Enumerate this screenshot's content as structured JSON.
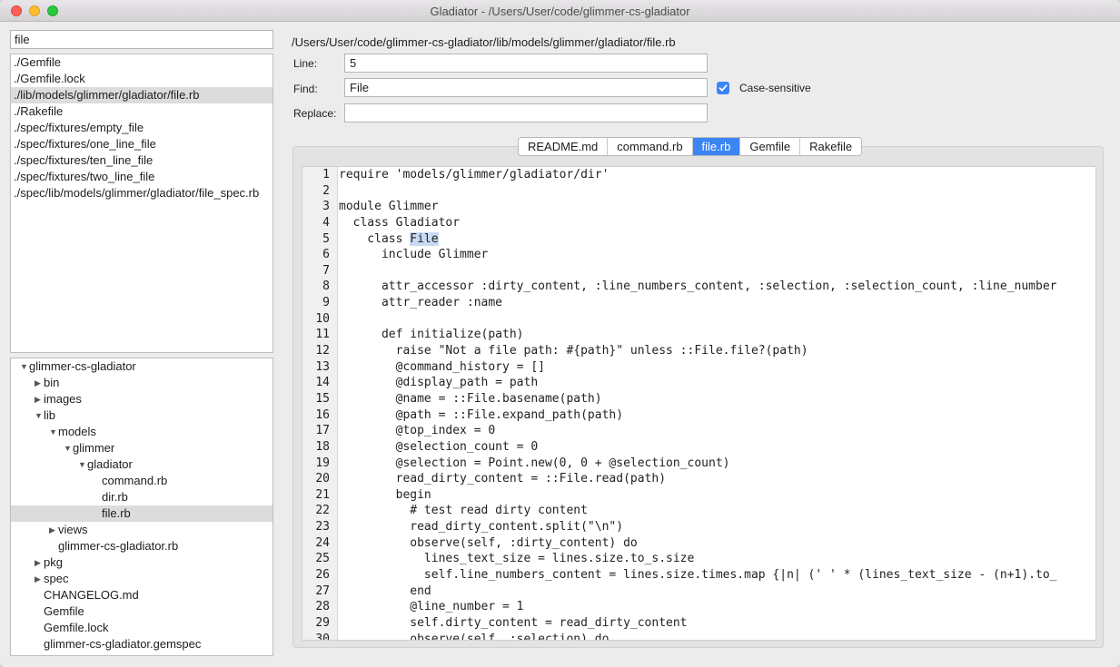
{
  "window": {
    "title": "Gladiator - /Users/User/code/glimmer-cs-gladiator"
  },
  "search": {
    "value": "file"
  },
  "file_list": [
    {
      "label": "./Gemfile",
      "selected": false
    },
    {
      "label": "./Gemfile.lock",
      "selected": false
    },
    {
      "label": "./lib/models/glimmer/gladiator/file.rb",
      "selected": true
    },
    {
      "label": "./Rakefile",
      "selected": false
    },
    {
      "label": "./spec/fixtures/empty_file",
      "selected": false
    },
    {
      "label": "./spec/fixtures/one_line_file",
      "selected": false
    },
    {
      "label": "./spec/fixtures/ten_line_file",
      "selected": false
    },
    {
      "label": "./spec/fixtures/two_line_file",
      "selected": false
    },
    {
      "label": "./spec/lib/models/glimmer/gladiator/file_spec.rb",
      "selected": false
    }
  ],
  "tree": [
    {
      "label": "glimmer-cs-gladiator",
      "depth": 0,
      "toggle": "expanded",
      "selected": false
    },
    {
      "label": "bin",
      "depth": 1,
      "toggle": "collapsed",
      "selected": false
    },
    {
      "label": "images",
      "depth": 1,
      "toggle": "collapsed",
      "selected": false
    },
    {
      "label": "lib",
      "depth": 1,
      "toggle": "expanded",
      "selected": false
    },
    {
      "label": "models",
      "depth": 2,
      "toggle": "expanded",
      "selected": false
    },
    {
      "label": "glimmer",
      "depth": 3,
      "toggle": "expanded",
      "selected": false
    },
    {
      "label": "gladiator",
      "depth": 4,
      "toggle": "expanded",
      "selected": false
    },
    {
      "label": "command.rb",
      "depth": 5,
      "toggle": "none",
      "selected": false
    },
    {
      "label": "dir.rb",
      "depth": 5,
      "toggle": "none",
      "selected": false
    },
    {
      "label": "file.rb",
      "depth": 5,
      "toggle": "none",
      "selected": true
    },
    {
      "label": "views",
      "depth": 2,
      "toggle": "collapsed",
      "selected": false
    },
    {
      "label": "glimmer-cs-gladiator.rb",
      "depth": 2,
      "toggle": "none",
      "selected": false
    },
    {
      "label": "pkg",
      "depth": 1,
      "toggle": "collapsed",
      "selected": false
    },
    {
      "label": "spec",
      "depth": 1,
      "toggle": "collapsed",
      "selected": false
    },
    {
      "label": "CHANGELOG.md",
      "depth": 1,
      "toggle": "none",
      "selected": false
    },
    {
      "label": "Gemfile",
      "depth": 1,
      "toggle": "none",
      "selected": false
    },
    {
      "label": "Gemfile.lock",
      "depth": 1,
      "toggle": "none",
      "selected": false
    },
    {
      "label": "glimmer-cs-gladiator.gemspec",
      "depth": 1,
      "toggle": "none",
      "selected": false
    }
  ],
  "editor_path": "/Users/User/code/glimmer-cs-gladiator/lib/models/glimmer/gladiator/file.rb",
  "fields": {
    "line_label": "Line:",
    "line_value": "5",
    "find_label": "Find:",
    "find_value": "File",
    "replace_label": "Replace:",
    "replace_value": "",
    "case_sensitive_label": "Case-sensitive",
    "case_sensitive_checked": true
  },
  "tabs": [
    {
      "label": "README.md",
      "active": false
    },
    {
      "label": "command.rb",
      "active": false
    },
    {
      "label": "file.rb",
      "active": true
    },
    {
      "label": "Gemfile",
      "active": false
    },
    {
      "label": "Rakefile",
      "active": false
    }
  ],
  "highlight": {
    "line": 5,
    "text": "File"
  },
  "code_lines": [
    "require 'models/glimmer/gladiator/dir'",
    "",
    "module Glimmer",
    "  class Gladiator",
    "    class File",
    "      include Glimmer",
    "",
    "      attr_accessor :dirty_content, :line_numbers_content, :selection, :selection_count, :line_number",
    "      attr_reader :name",
    "",
    "      def initialize(path)",
    "        raise \"Not a file path: #{path}\" unless ::File.file?(path)",
    "        @command_history = []",
    "        @display_path = path",
    "        @name = ::File.basename(path)",
    "        @path = ::File.expand_path(path)",
    "        @top_index = 0",
    "        @selection_count = 0",
    "        @selection = Point.new(0, 0 + @selection_count)",
    "        read_dirty_content = ::File.read(path)",
    "        begin",
    "          # test read dirty content",
    "          read_dirty_content.split(\"\\n\")",
    "          observe(self, :dirty_content) do",
    "            lines_text_size = lines.size.to_s.size",
    "            self.line_numbers_content = lines.size.times.map {|n| (' ' * (lines_text_size - (n+1).to_",
    "          end",
    "          @line_number = 1",
    "          self.dirty_content = read_dirty_content",
    "          observe(self, :selection) do"
  ]
}
